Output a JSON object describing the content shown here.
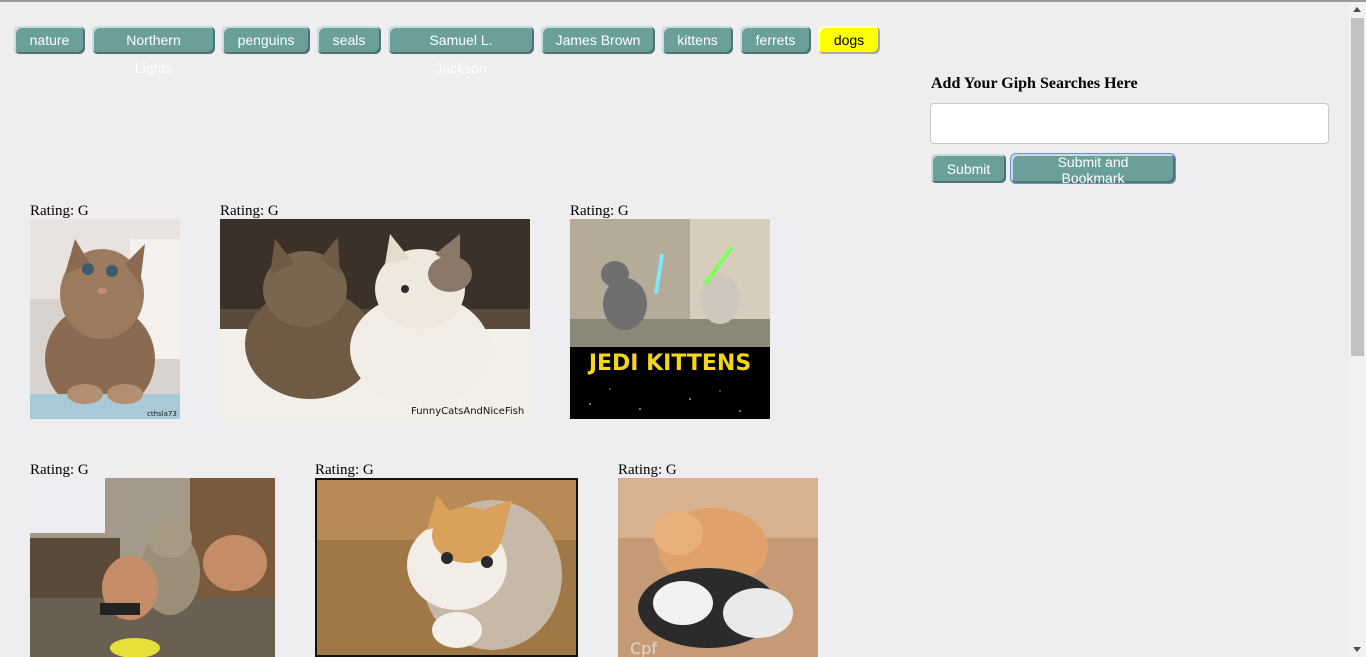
{
  "topics": [
    "nature",
    "Northern Lights",
    "penguins",
    "seals",
    "Samuel L. Jackson",
    "James Brown",
    "kittens",
    "ferrets",
    "dogs"
  ],
  "form": {
    "label": "Add Your Giph Searches Here",
    "input_value": "",
    "submit_label": "Submit",
    "bookmark_label": "Submit and Bookmark"
  },
  "gifs": [
    {
      "rating": "Rating: G",
      "caption": "",
      "watermark": "cthsla73"
    },
    {
      "rating": "Rating: G",
      "caption": "FunnyCatsAndNiceFish",
      "watermark": ""
    },
    {
      "rating": "Rating: G",
      "caption": "JEDI KITTENS",
      "watermark": ""
    },
    {
      "rating": "Rating: G",
      "caption": "",
      "watermark": ""
    },
    {
      "rating": "Rating: G",
      "caption": "",
      "watermark": ""
    },
    {
      "rating": "Rating: G",
      "caption": "",
      "watermark": "Cpf"
    }
  ],
  "colors": {
    "button": "#6a9f9c",
    "highlight": "#ffff00",
    "background": "#eeeef0"
  }
}
